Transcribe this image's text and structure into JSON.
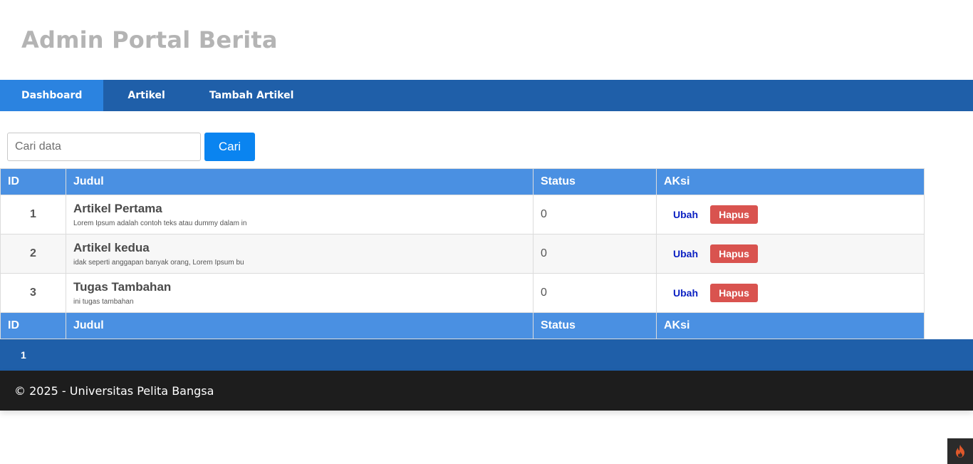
{
  "header": {
    "title": "Admin Portal Berita"
  },
  "nav": {
    "items": [
      {
        "label": "Dashboard",
        "active": true
      },
      {
        "label": "Artikel",
        "active": false
      },
      {
        "label": "Tambah Artikel",
        "active": false
      }
    ]
  },
  "search": {
    "placeholder": "Cari data",
    "value": "",
    "button_label": "Cari"
  },
  "table": {
    "columns": [
      "ID",
      "Judul",
      "Status",
      "AKsi"
    ],
    "footer_columns": [
      "ID",
      "Judul",
      "Status",
      "AKsi"
    ],
    "rows": [
      {
        "id": "1",
        "title": "Artikel Pertama",
        "excerpt": "Lorem Ipsum adalah contoh teks atau dummy dalam in",
        "status": "0",
        "edit_label": "Ubah",
        "delete_label": "Hapus"
      },
      {
        "id": "2",
        "title": "Artikel kedua",
        "excerpt": "idak seperti anggapan banyak orang, Lorem Ipsum bu",
        "status": "0",
        "edit_label": "Ubah",
        "delete_label": "Hapus"
      },
      {
        "id": "3",
        "title": "Tugas Tambahan",
        "excerpt": "ini tugas tambahan",
        "status": "0",
        "edit_label": "Ubah",
        "delete_label": "Hapus"
      }
    ]
  },
  "pagination": {
    "pages": [
      "1"
    ]
  },
  "footer": {
    "text": "© 2025 - Universitas Pelita Bangsa"
  },
  "colors": {
    "nav_bg": "#1f5fa9",
    "nav_active": "#2b83e0",
    "table_header": "#4a90e2",
    "search_button": "#0a84f0",
    "delete_button": "#d9534f",
    "edit_link": "#0a1fc2",
    "footer_bg": "#1d1d1d",
    "title_color": "#b4b4b4"
  },
  "icons": {
    "debug_toolbar": "flame-icon"
  }
}
